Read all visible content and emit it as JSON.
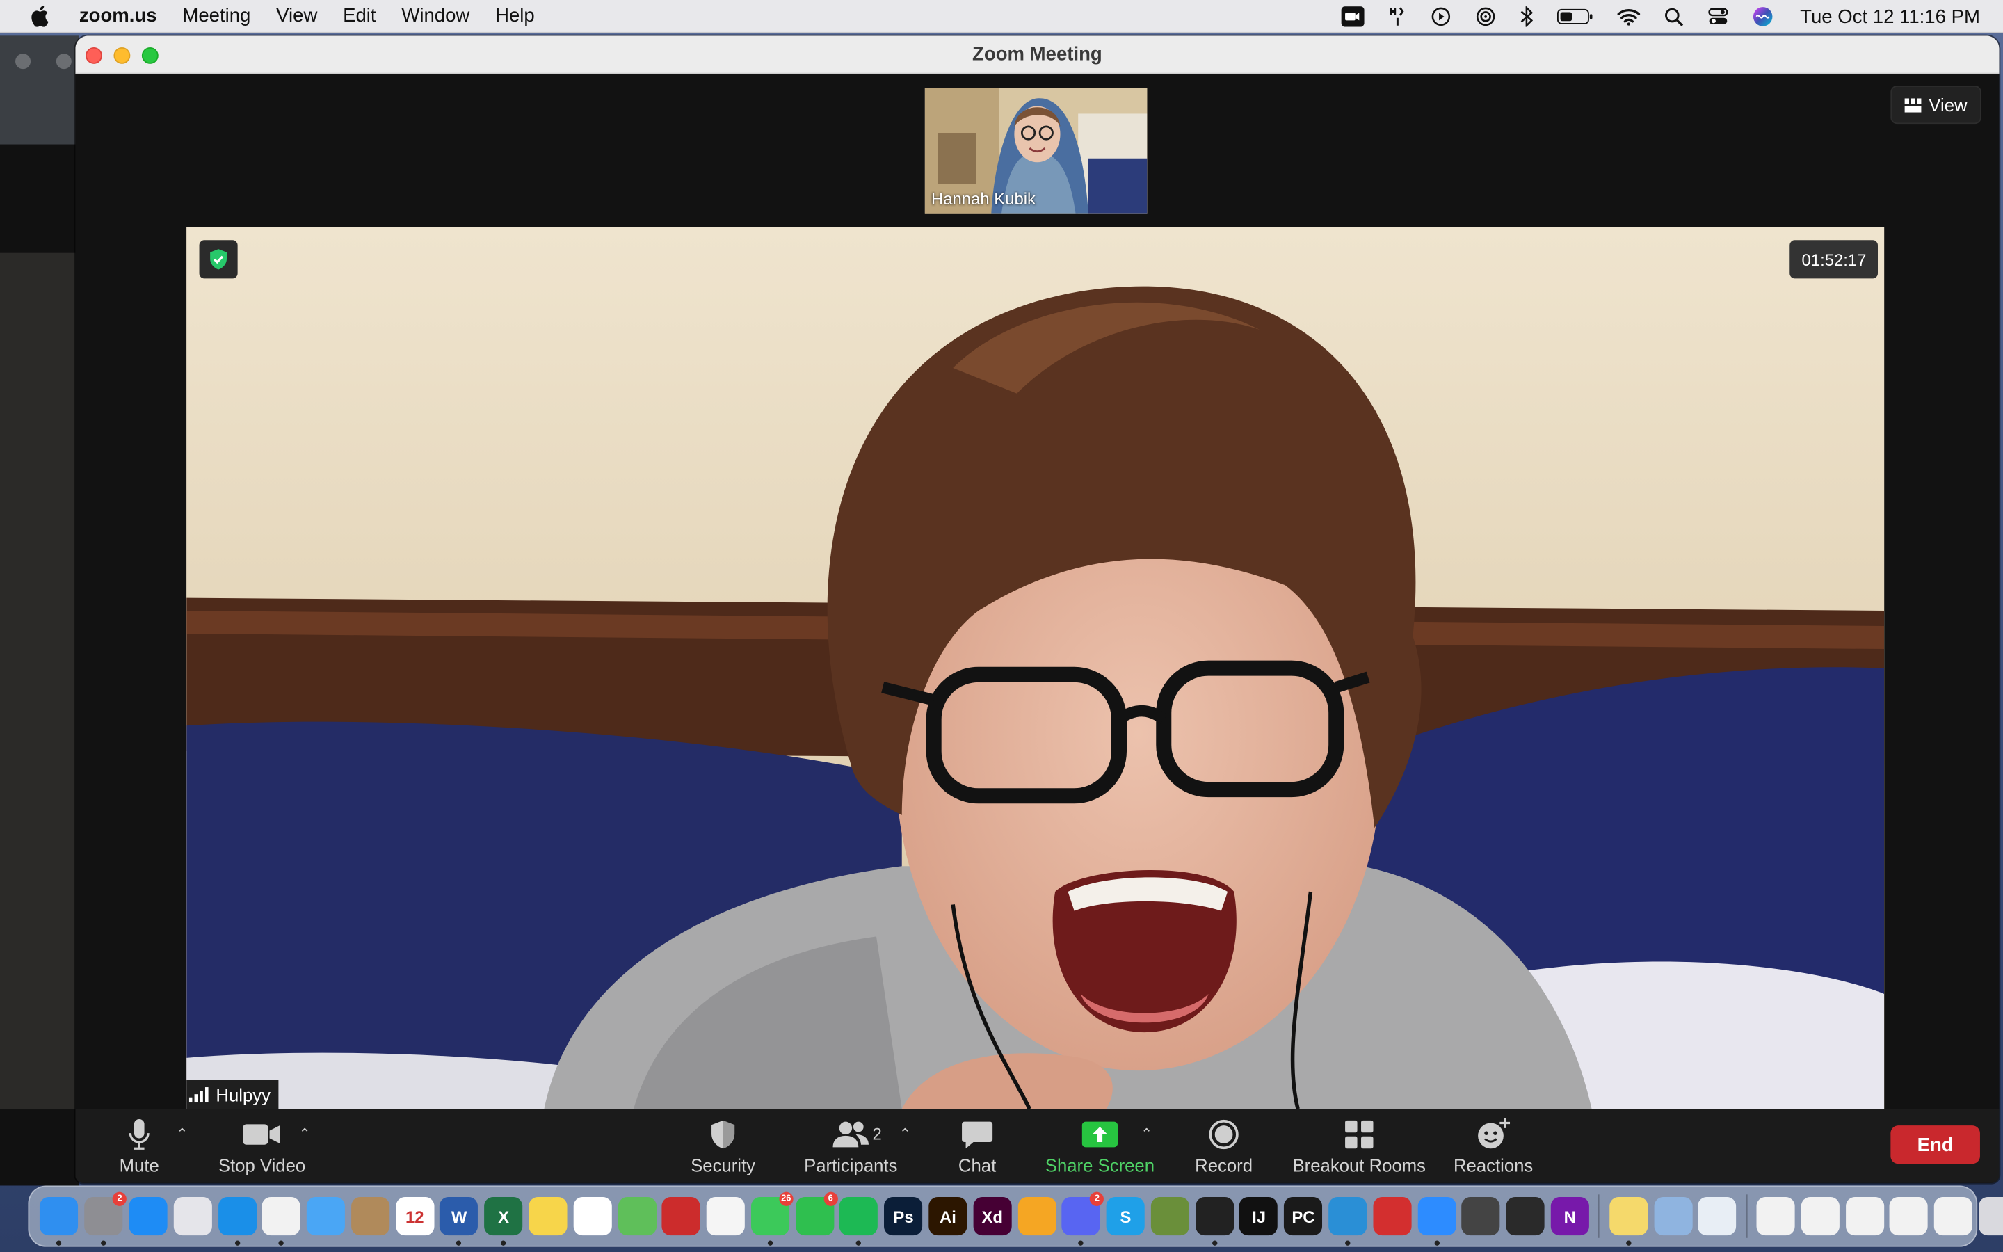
{
  "menubar": {
    "app_name": "zoom.us",
    "items": [
      "Meeting",
      "View",
      "Edit",
      "Window",
      "Help"
    ],
    "clock": "Tue Oct 12  11:16 PM",
    "status_icons": [
      "zoom-status-icon",
      "airdrop-icon",
      "play-icon",
      "airplay-icon",
      "bluetooth-icon",
      "battery-icon",
      "wifi-icon",
      "spotlight-search-icon",
      "control-center-icon",
      "siri-icon"
    ]
  },
  "window": {
    "title": "Zoom Meeting",
    "view_label": "View"
  },
  "participants": {
    "thumbnail_name": "Hannah Kubik",
    "active_speaker_name": "Hulpyy",
    "count": "2"
  },
  "meeting": {
    "elapsed": "01:52:17"
  },
  "toolbar": {
    "mute": "Mute",
    "stop_video": "Stop Video",
    "security": "Security",
    "participants": "Participants",
    "chat": "Chat",
    "share_screen": "Share Screen",
    "record": "Record",
    "breakout_rooms": "Breakout Rooms",
    "reactions": "Reactions",
    "end": "End"
  },
  "dock": {
    "apps": [
      {
        "name": "finder",
        "color": "#2f8ff0"
      },
      {
        "name": "system-preferences",
        "color": "#8e8e93",
        "badge": "2"
      },
      {
        "name": "app-store",
        "color": "#1e8cf5"
      },
      {
        "name": "launchpad",
        "color": "#e5e5ea"
      },
      {
        "name": "safari",
        "color": "#1a8fe8"
      },
      {
        "name": "chrome",
        "color": "#f2f2f2"
      },
      {
        "name": "mail",
        "color": "#4aa6f5"
      },
      {
        "name": "contacts",
        "color": "#b08a5b"
      },
      {
        "name": "calendar",
        "color": "#ffffff",
        "text": "12"
      },
      {
        "name": "word",
        "color": "#2b5cab",
        "text": "W"
      },
      {
        "name": "excel",
        "color": "#1f7244",
        "text": "X"
      },
      {
        "name": "notes",
        "color": "#f7d54a"
      },
      {
        "name": "reminders",
        "color": "#ffffff"
      },
      {
        "name": "maps",
        "color": "#5fbf5a"
      },
      {
        "name": "photo-booth",
        "color": "#cc2c2c"
      },
      {
        "name": "photos",
        "color": "#f5f5f5"
      },
      {
        "name": "messages",
        "color": "#3cc95a",
        "badge": "26"
      },
      {
        "name": "facetime",
        "color": "#2fbf4f",
        "badge": "6"
      },
      {
        "name": "spotify",
        "color": "#1db954"
      },
      {
        "name": "photoshop",
        "color": "#0b1e38",
        "text": "Ps"
      },
      {
        "name": "illustrator",
        "color": "#2c1600",
        "text": "Ai"
      },
      {
        "name": "xd",
        "color": "#460034",
        "text": "Xd"
      },
      {
        "name": "pages",
        "color": "#f5a623"
      },
      {
        "name": "discord",
        "color": "#5865f2",
        "badge": "2"
      },
      {
        "name": "skype",
        "color": "#1fa0e8",
        "text": "S"
      },
      {
        "name": "minecraft",
        "color": "#6a8f3a"
      },
      {
        "name": "terminal",
        "color": "#222222"
      },
      {
        "name": "intellij",
        "color": "#111111",
        "text": "IJ"
      },
      {
        "name": "pycharm",
        "color": "#1a1a1a",
        "text": "PC"
      },
      {
        "name": "vscode",
        "color": "#2a8fd6"
      },
      {
        "name": "autodesk",
        "color": "#d32f2f"
      },
      {
        "name": "zoom",
        "color": "#2d8cff"
      },
      {
        "name": "chess",
        "color": "#444444"
      },
      {
        "name": "activity-monitor",
        "color": "#2a2a2a"
      },
      {
        "name": "onenote",
        "color": "#7719aa",
        "text": "N"
      },
      {
        "name": "stickies",
        "color": "#f5d96b"
      },
      {
        "name": "preview",
        "color": "#8fb4e0"
      },
      {
        "name": "kindle",
        "color": "#e8eef5"
      },
      {
        "name": "document-1",
        "color": "#f2f2f2"
      },
      {
        "name": "document-2",
        "color": "#f2f2f2"
      },
      {
        "name": "document-3",
        "color": "#f2f2f2"
      },
      {
        "name": "document-4",
        "color": "#f2f2f2"
      },
      {
        "name": "document-5",
        "color": "#f2f2f2"
      },
      {
        "name": "trash",
        "color": "#d9d9de"
      }
    ]
  }
}
